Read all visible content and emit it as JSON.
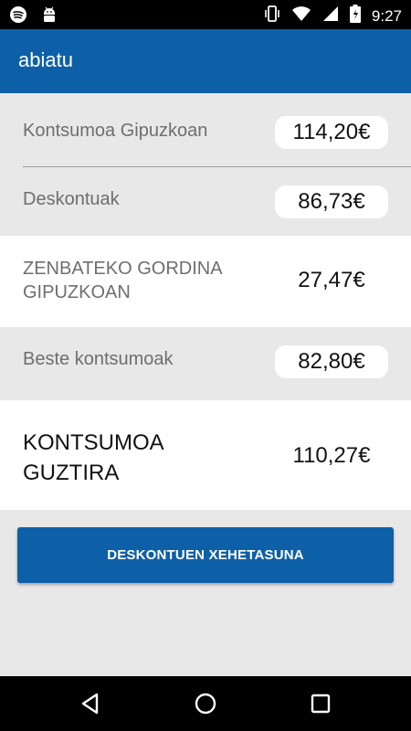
{
  "status_bar": {
    "time": "9:27",
    "icons_left": [
      "spotify-icon",
      "android-icon"
    ],
    "icons_right": [
      "vibrate-icon",
      "wifi-icon",
      "signal-icon",
      "battery-icon"
    ]
  },
  "app_bar": {
    "title": "abiatu"
  },
  "rows": [
    {
      "label": "Kontsumoa Gipuzkoan",
      "value": "114,20€"
    },
    {
      "label": "Deskontuak",
      "value": "86,73€"
    },
    {
      "label": "ZENBATEKO GORDINA GIPUZKOAN",
      "value": "27,47€"
    },
    {
      "label": "Beste kontsumoak",
      "value": "82,80€"
    },
    {
      "label": "KONTSUMOA GUZTIRA",
      "value": "110,27€"
    }
  ],
  "button": {
    "label": "DESKONTUEN XEHETASUNA"
  },
  "nav_bar": {
    "icons": [
      "back-icon",
      "home-icon",
      "recents-icon"
    ]
  },
  "colors": {
    "primary": "#0d60a8",
    "background": "#e8e8e8",
    "white": "#ffffff"
  }
}
